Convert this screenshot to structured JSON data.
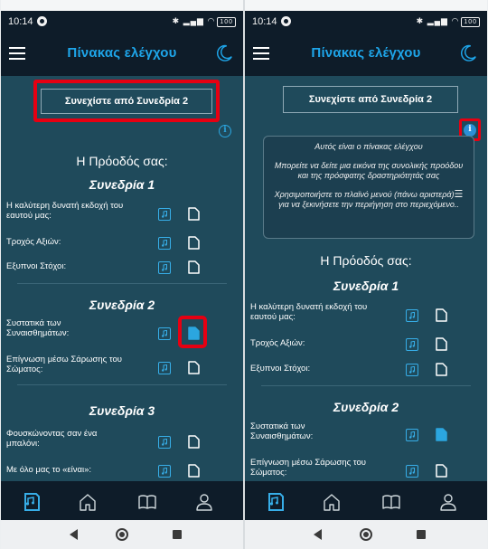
{
  "status": {
    "time": "10:14",
    "battery": "100"
  },
  "app": {
    "title": "Πίνακας ελέγχου"
  },
  "continue_label": "Συνεχίστε από Συνεδρία 2",
  "info_glyph": "i",
  "progress_heading": "Η Πρόοδός σας:",
  "sessions": [
    {
      "title": "Συνεδρία 1",
      "items": [
        "Η καλύτερη δυνατή εκδοχή του εαυτού μας:",
        "Τροχός Αξιών:",
        "Εξυπνοι Στόχοι:"
      ]
    },
    {
      "title": "Συνεδρία 2",
      "items": [
        "Συστατικά των Συναισθημάτων:",
        "Επίγνωση μέσω Σάρωσης του Σώματος:"
      ]
    },
    {
      "title": "Συνεδρία 3",
      "items": [
        "Φουσκώνοντας σαν ένα μπαλόνι:",
        "Με όλο μας το «είναι»:"
      ]
    }
  ],
  "tooltip": {
    "line1": "Αυτός είναι ο πίνακας ελέγχου",
    "line2": "Μπορείτε να δείτε μια εικόνα της συνολικής προόδου και της πρόσφατης δραστηριότητάς σας",
    "line3a": "Χρησιμοποιήστε το πλαϊνό μενού (πάνω αριστερά)",
    "menu_glyph": "☰",
    "line3b": "για να ξεκινήσετε την περιήγηση στο περιεχόμενο.."
  },
  "colors": {
    "accent": "#1ea5e9",
    "content_bg": "#1f4a5b",
    "bar_bg": "#0e1c29",
    "highlight": "#e60012"
  }
}
